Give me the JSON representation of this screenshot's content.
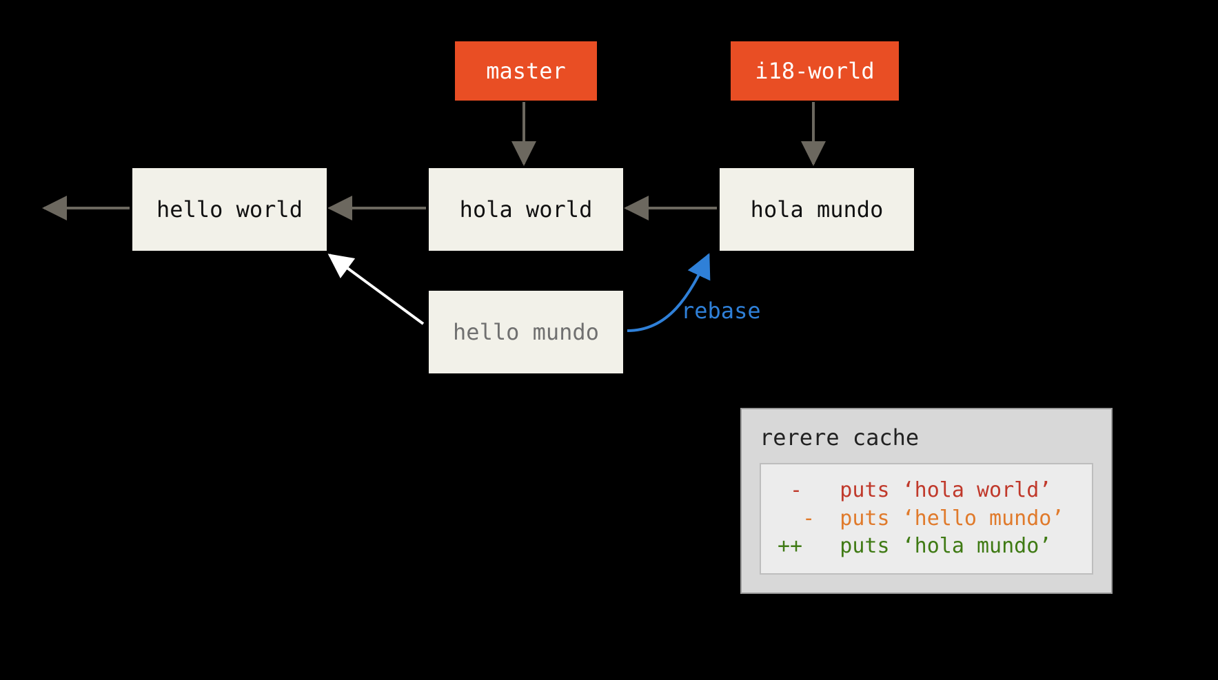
{
  "branches": {
    "master": {
      "label": "master"
    },
    "i18world": {
      "label": "i18-world"
    }
  },
  "commits": {
    "hello_world": {
      "label": "hello world"
    },
    "hola_world": {
      "label": "hola world"
    },
    "hola_mundo": {
      "label": "hola mundo"
    },
    "hello_mundo": {
      "label": "hello mundo"
    }
  },
  "rebase": {
    "label": "rebase"
  },
  "cache": {
    "title": "rerere cache",
    "lines": [
      {
        "kind": "red",
        "text": " -   puts ‘hola world’"
      },
      {
        "kind": "orange",
        "text": "  -  puts ‘hello mundo’"
      },
      {
        "kind": "green",
        "text": "++   puts ‘hola mundo’"
      }
    ]
  },
  "colors": {
    "branch_bg": "#e94e24",
    "commit_bg": "#f2f1e9",
    "rebase": "#2f80d8",
    "diff_red": "#c0392b",
    "diff_orange": "#e07a2b",
    "diff_green": "#3f7a14"
  }
}
